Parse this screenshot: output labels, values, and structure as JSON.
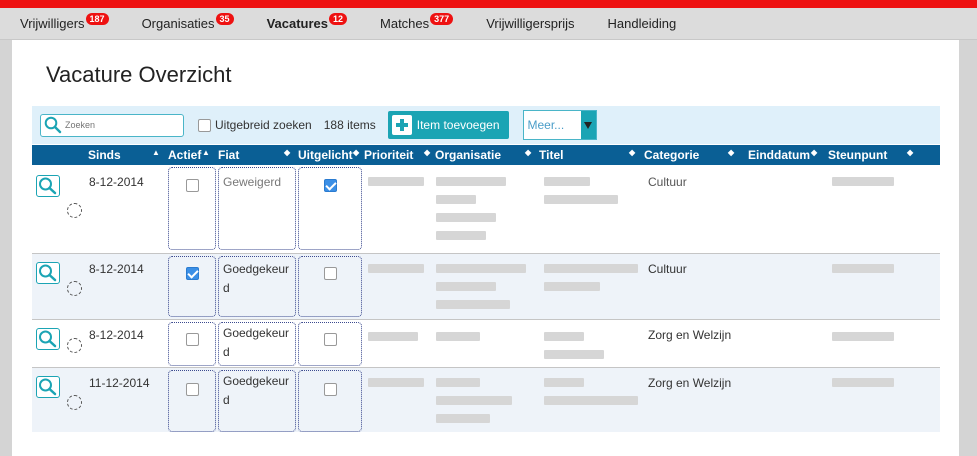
{
  "nav": {
    "items": [
      {
        "label": "Vrijwilligers",
        "badge": "187",
        "active": false
      },
      {
        "label": "Organisaties",
        "badge": "35",
        "active": false
      },
      {
        "label": "Vacatures",
        "badge": "12",
        "active": true
      },
      {
        "label": "Matches",
        "badge": "377",
        "active": false
      },
      {
        "label": "Vrijwilligersprijs",
        "badge": "",
        "active": false
      },
      {
        "label": "Handleiding",
        "badge": "",
        "active": false
      }
    ]
  },
  "page": {
    "title": "Vacature Overzicht"
  },
  "toolbar": {
    "search_placeholder": "Zoeken",
    "advanced_search_label": "Uitgebreid zoeken",
    "item_count": "188 items",
    "add_button_label": "Item toevoegen",
    "more_select_value": "Meer..."
  },
  "table": {
    "columns": [
      "Sinds",
      "Actief",
      "Fiat",
      "Uitgelicht",
      "Prioriteit",
      "Organisatie",
      "Titel",
      "Categorie",
      "Einddatum",
      "Steunpunt"
    ],
    "rows": [
      {
        "date": "8-12-2014",
        "actief": false,
        "fiat": "Geweigerd",
        "uitgelicht": true,
        "categorie": "Cultuur"
      },
      {
        "date": "8-12-2014",
        "actief": true,
        "fiat": "Goedgekeurd",
        "uitgelicht": false,
        "categorie": "Cultuur"
      },
      {
        "date": "8-12-2014",
        "actief": false,
        "fiat": "Goedgekeurd",
        "uitgelicht": false,
        "categorie": "Zorg en Welzijn"
      },
      {
        "date": "11-12-2014",
        "actief": false,
        "fiat": "Goedgekeurd",
        "uitgelicht": false,
        "categorie": "Zorg en Welzijn"
      }
    ]
  },
  "icons": {
    "search": "search-icon",
    "add": "plus-icon",
    "view": "magnifier-icon",
    "loading": "spinner-icon",
    "dropdown": "caret-down-icon",
    "sort": "sort-icon"
  },
  "colors": {
    "topbar": "#ee1111",
    "header": "#0a5f95",
    "accent": "#1ba4b4",
    "badge": "#ee1111"
  }
}
